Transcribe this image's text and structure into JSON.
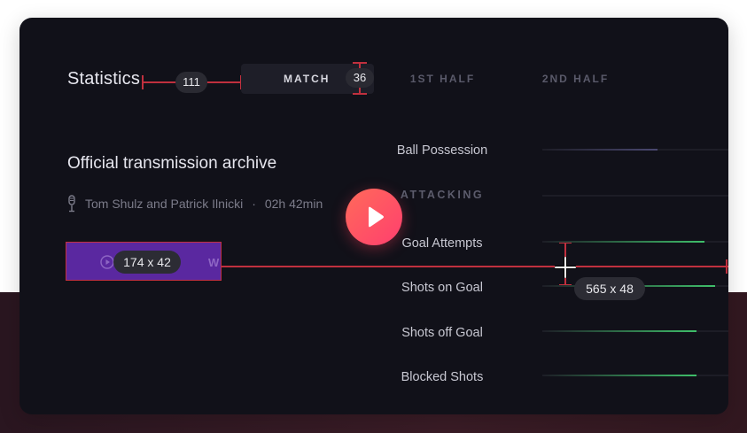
{
  "header": {
    "title": "Statistics",
    "tabs": [
      {
        "label": "MATCH",
        "active": true
      },
      {
        "label": "1ST HALF",
        "active": false
      },
      {
        "label": "2ND HALF",
        "active": false
      }
    ],
    "spacing_badge": "111",
    "tab_height_badge": "36"
  },
  "archive": {
    "title": "Official transmission archive",
    "authors": "Tom Shulz and Patrick Ilnicki",
    "separator": "·",
    "duration": "02h 42min",
    "button_partial_label": "W",
    "button_size_badge": "174 x 42"
  },
  "stats": {
    "ball_possession": {
      "label": "Ball Possession",
      "fill": 0.62,
      "color": "#4a4870"
    },
    "section_heading": "ATTACKING",
    "rows": [
      {
        "label": "Goal Attempts",
        "fill": 0.87
      },
      {
        "label": "Shots on Goal",
        "fill": 0.93
      },
      {
        "label": "Shots off Goal",
        "fill": 0.83
      },
      {
        "label": "Blocked Shots",
        "fill": 0.83
      }
    ],
    "bar_color": "#3fbf6a",
    "row_size_badge": "565 x 48"
  },
  "colors": {
    "card_bg": "#111119",
    "accent_play": "#ff4f68",
    "button_purple": "#5a28a0",
    "measure_red": "#c0303e"
  },
  "icons": [
    "microphone-icon",
    "play-icon",
    "crosshair-icon"
  ]
}
